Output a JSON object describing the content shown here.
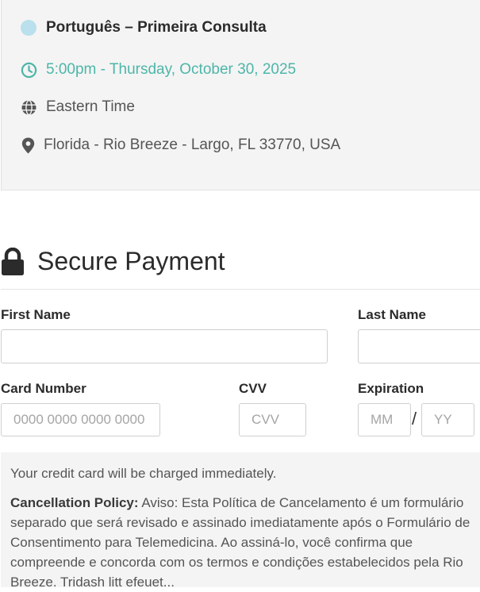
{
  "appointment": {
    "service": "Português – Primeira Consulta",
    "time": "5:00pm - Thursday, October 30, 2025",
    "timezone": "Eastern Time",
    "location": "Florida - Rio Breeze - Largo, FL 33770, USA"
  },
  "payment": {
    "title": "Secure Payment",
    "first_name_label": "First Name",
    "last_name_label": "Last Name",
    "card_number_label": "Card Number",
    "card_number_placeholder": "0000 0000 0000 0000",
    "cvv_label": "CVV",
    "cvv_placeholder": "CVV",
    "expiration_label": "Expiration",
    "month_placeholder": "MM",
    "expiry_separator": "/",
    "year_placeholder": "YY"
  },
  "notice": {
    "charge_text": "Your credit card will be charged immediately.",
    "policy_label": "Cancellation Policy:",
    "policy_text": " Aviso: Esta Política de Cancelamento é um formulário separado que será revisado e assinado imediatamente após o Formulário de Consentimento para Telemedicina. Ao assiná-lo, você confirma que compreende e concorda com os termos e condições estabelecidos pela Rio Breeze. Tridash litt efeuet..."
  },
  "colors": {
    "accent_teal": "#4db6a8",
    "dot_color": "#b9e0ec",
    "panel_bg": "#f4f4f4"
  },
  "icons": [
    "clock-icon",
    "globe-icon",
    "map-pin-icon",
    "lock-icon"
  ]
}
